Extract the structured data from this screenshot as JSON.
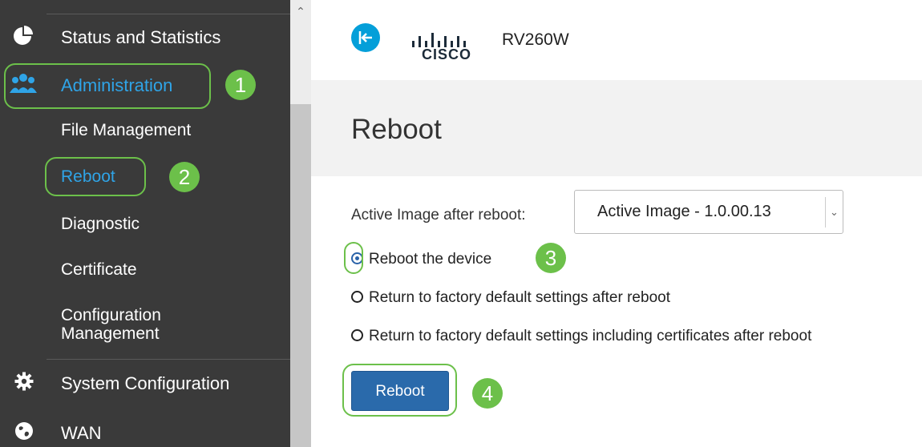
{
  "sidebar": {
    "status_stats": "Status and Statistics",
    "administration": "Administration",
    "sub_items": {
      "file_management": "File Management",
      "reboot": "Reboot",
      "diagnostic": "Diagnostic",
      "certificate": "Certificate",
      "configuration_management_line1": "Configuration",
      "configuration_management_line2": "Management"
    },
    "system_configuration": "System Configuration",
    "wan": "WAN"
  },
  "header": {
    "brand": "CISCO",
    "model": "RV260W"
  },
  "page": {
    "title": "Reboot",
    "active_image_label": "Active Image after reboot:",
    "active_image_value": "Active Image - 1.0.00.13",
    "options": [
      {
        "label": "Reboot the device",
        "checked": true
      },
      {
        "label": "Return to factory default settings after reboot",
        "checked": false
      },
      {
        "label": "Return to factory default settings including certificates after reboot",
        "checked": false
      }
    ],
    "reboot_button": "Reboot"
  },
  "callouts": [
    "1",
    "2",
    "3",
    "4"
  ],
  "colors": {
    "sidebar_bg": "#3a3a3a",
    "accent_blue": "#2fa4e7",
    "callout_green": "#6cc04a",
    "button_blue": "#2a6aab",
    "cisco_blue": "#049fd9"
  }
}
